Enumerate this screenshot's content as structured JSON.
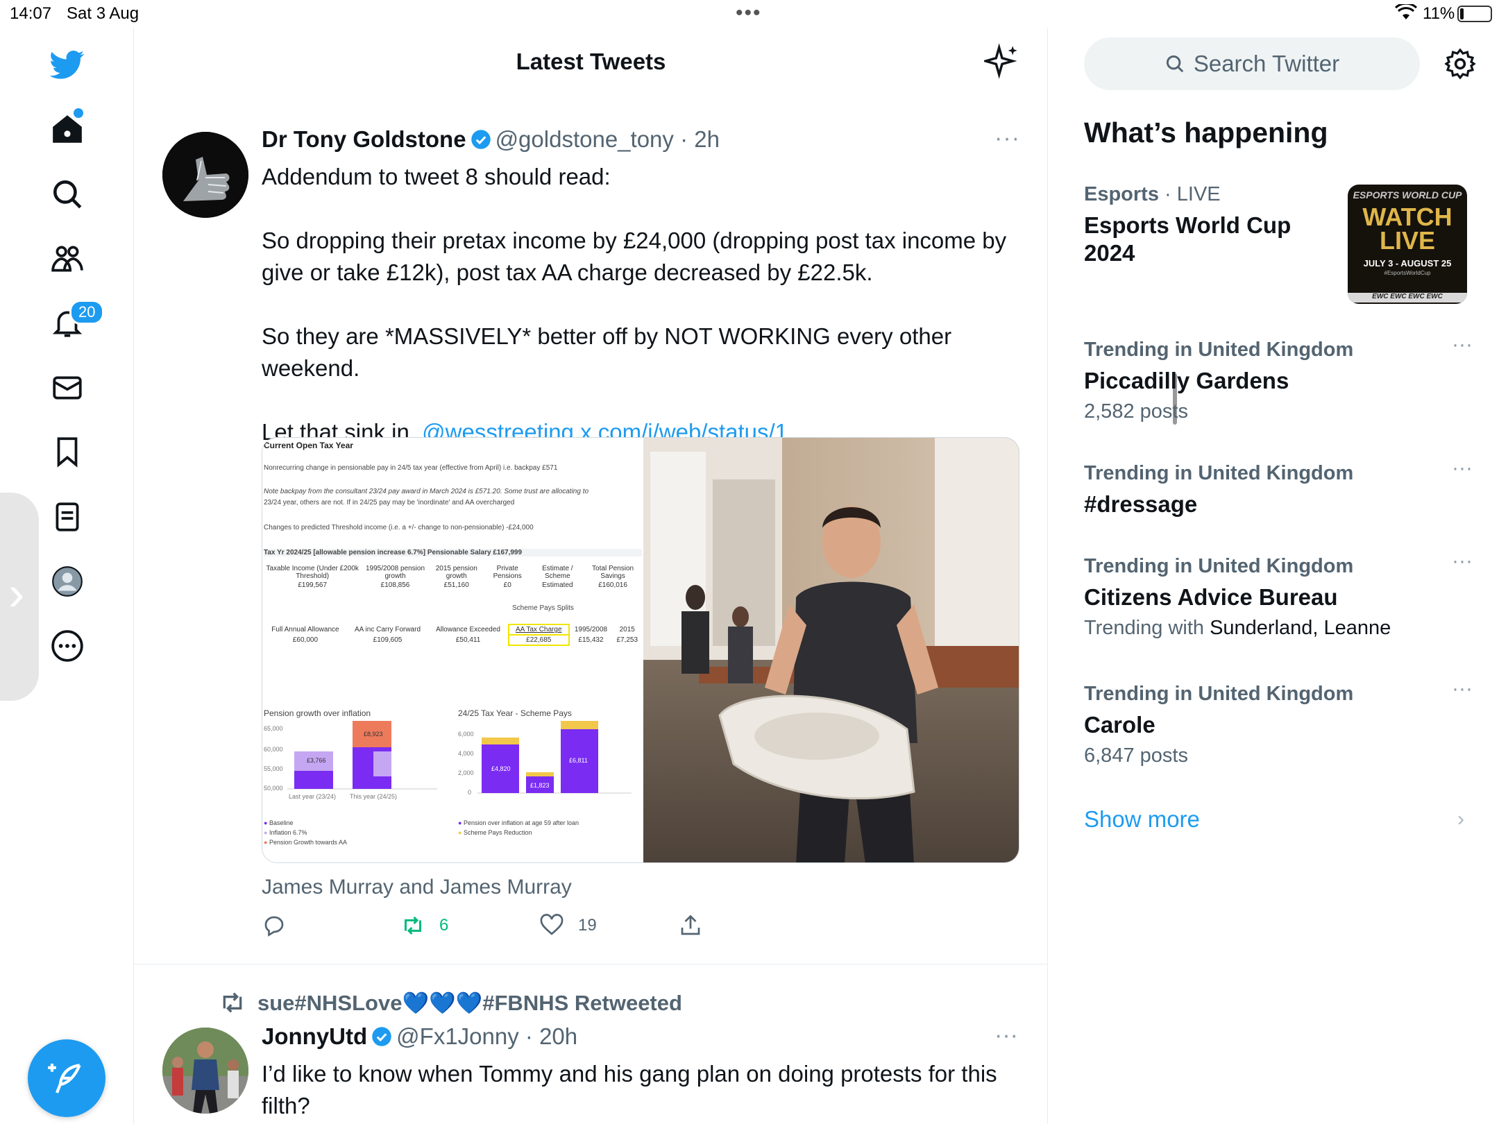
{
  "status_bar": {
    "time": "14:07",
    "date": "Sat 3 Aug",
    "battery": "11%"
  },
  "nav": {
    "notifications_badge": "20"
  },
  "header": {
    "title": "Latest Tweets"
  },
  "tweet1": {
    "name": "Dr Tony Goldstone",
    "handle": "@goldstone_tony",
    "time": "· 2h",
    "more": "···",
    "lines": [
      "Addendum to tweet 8 should read:",
      "So dropping their pretax income by £24,000 (dropping post tax income by give or take £12k), post tax AA charge decreased by £22.5k.",
      "So they are *MASSIVELY* better off by NOT WORKING every other weekend."
    ],
    "last_line_prefix": "Let that sink in",
    "mention": "@wesstreeting",
    "link": "x.com/i/web/status/1…",
    "caption": "James Murray and James Murray",
    "retweets": "6",
    "likes": "19",
    "sheet": {
      "title": "Current Open Tax Year",
      "row1": "Nonrecurring change in pensionable pay in 24/5 tax year (effective from April) i.e. backpay   £571",
      "row2": "Note backpay from the consultant 23/24 pay award in March 2024 is £571.20. Some trust are allocating to",
      "row3": "23/24 year, others are not. If in 24/25 pay may be 'inordinate' and AA overcharged",
      "row4": "Changes to predicted Threshold income (i.e. a +/- change to non-pensionable)   -£24,000",
      "row5": "Tax Yr 2024/25 [allowable pension increase 6.7%]        Pensionable Salary        £167,999",
      "h1": [
        "Taxable Income (Under £200k Threshold)",
        "1995/2008 pension growth",
        "2015 pension growth",
        "Private Pensions",
        "Estimate / Scheme",
        "Total Pension Savings"
      ],
      "v1": [
        "£199,567",
        "£108,856",
        "£51,160",
        "£0",
        "Estimated",
        "£160,016"
      ],
      "splits": "Scheme Pays Splits",
      "h2": [
        "Full Annual Allowance",
        "AA inc Carry Forward",
        "Allowance Exceeded",
        "AA Tax Charge",
        "1995/2008",
        "2015"
      ],
      "v2": [
        "£60,000",
        "£109,605",
        "£50,411",
        "£22,685",
        "£15,432",
        "£7,253"
      ],
      "chart1_title": "Pension growth over inflation",
      "chart1_legend": [
        "Baseline",
        "Inflation 6.7%",
        "Pension Growth towards AA"
      ],
      "chart2_title": "24/25 Tax Year - Scheme Pays",
      "chart2_legend": [
        "Pension over inflation at age 59 after loan",
        "Scheme Pays Reduction"
      ]
    }
  },
  "tweet2": {
    "retweeted_by": "sue#NHSLove💙💙💙#FBNHS Retweeted",
    "name": "JonnyUtd",
    "handle": "@Fx1Jonny",
    "time": "· 20h",
    "more": "···",
    "text": "I’d like to know when Tommy and his gang plan on doing protests for this filth?"
  },
  "sidebar": {
    "search_placeholder": "Search Twitter",
    "title": "What’s happening",
    "trends": [
      {
        "context": "Esports",
        "context_suffix": "· LIVE",
        "topic": "Esports World Cup 2024"
      },
      {
        "context": "Trending in United Kingdom",
        "topic": "Piccadilly Gardens",
        "meta": "2,582 posts"
      },
      {
        "context": "Trending in United Kingdom",
        "topic": "#dressage"
      },
      {
        "context": "Trending in United Kingdom",
        "topic": "Citizens Advice Bureau",
        "meta_prefix": "Trending with",
        "meta_names": "Sunderland, Leanne"
      },
      {
        "context": "Trending in United Kingdom",
        "topic": "Carole",
        "meta": "6,847 posts"
      }
    ],
    "thumb": {
      "line1": "ESPORTS WORLD CUP",
      "line2": "WATCH LIVE",
      "line3": "JULY 3 - AUGUST 25",
      "line4": "#EsportsWorldCup",
      "stripe": "EWC  EWC  EWC  EWC"
    },
    "show_more": "Show more"
  },
  "colors": {
    "accent": "#1d9bf0",
    "text": "#0f1419",
    "muted": "#536471",
    "retweet_green": "#00ba7c"
  }
}
